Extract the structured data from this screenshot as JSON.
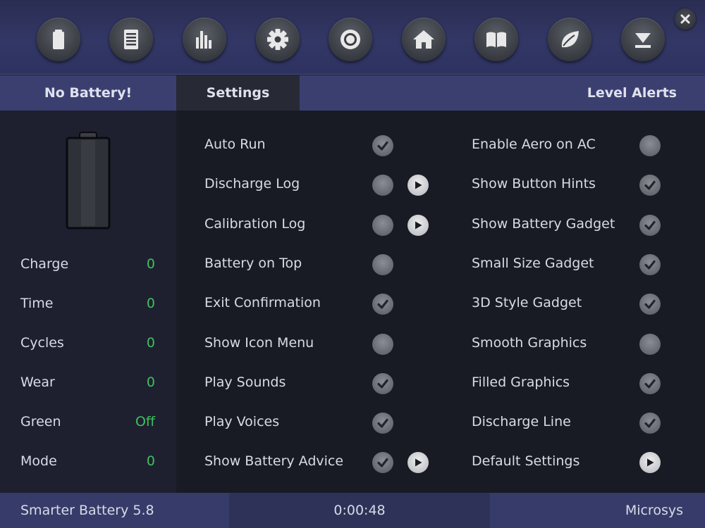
{
  "toolbar": {
    "buttons": [
      {
        "icon": "battery-icon"
      },
      {
        "icon": "document-icon"
      },
      {
        "icon": "bar-chart-icon"
      },
      {
        "icon": "gear-icon"
      },
      {
        "icon": "target-icon"
      },
      {
        "icon": "home-icon"
      },
      {
        "icon": "book-icon"
      },
      {
        "icon": "leaf-icon"
      },
      {
        "icon": "minimize-icon"
      }
    ],
    "close_icon": "close-icon"
  },
  "tabs": {
    "battery": "No Battery!",
    "settings": "Settings",
    "alerts": "Level Alerts"
  },
  "stats": [
    {
      "label": "Charge",
      "value": "0"
    },
    {
      "label": "Time",
      "value": "0"
    },
    {
      "label": "Cycles",
      "value": "0"
    },
    {
      "label": "Wear",
      "value": "0"
    },
    {
      "label": "Green",
      "value": "Off"
    },
    {
      "label": "Mode",
      "value": "0"
    }
  ],
  "settings_left": [
    {
      "label": "Auto Run",
      "checked": true,
      "has_arrow": false
    },
    {
      "label": "Discharge Log",
      "checked": false,
      "has_arrow": true
    },
    {
      "label": "Calibration Log",
      "checked": false,
      "has_arrow": true
    },
    {
      "label": "Battery on Top",
      "checked": false,
      "has_arrow": false
    },
    {
      "label": "Exit Confirmation",
      "checked": true,
      "has_arrow": false
    },
    {
      "label": "Show Icon Menu",
      "checked": false,
      "has_arrow": false
    },
    {
      "label": "Play Sounds",
      "checked": true,
      "has_arrow": false
    },
    {
      "label": "Play Voices",
      "checked": true,
      "has_arrow": false
    },
    {
      "label": "Show Battery Advice",
      "checked": true,
      "has_arrow": true
    }
  ],
  "settings_right": [
    {
      "label": "Enable Aero on AC",
      "checked": false,
      "has_arrow": false
    },
    {
      "label": "Show Button Hints",
      "checked": true,
      "has_arrow": false
    },
    {
      "label": "Show Battery Gadget",
      "checked": true,
      "has_arrow": false
    },
    {
      "label": "Small Size Gadget",
      "checked": true,
      "has_arrow": false
    },
    {
      "label": "3D Style Gadget",
      "checked": true,
      "has_arrow": false
    },
    {
      "label": "Smooth Graphics",
      "checked": false,
      "has_arrow": false
    },
    {
      "label": "Filled Graphics",
      "checked": true,
      "has_arrow": false
    },
    {
      "label": "Discharge Line",
      "checked": true,
      "has_arrow": false
    },
    {
      "label": "Default Settings",
      "checked": false,
      "has_arrow": true,
      "arrow_only": true
    }
  ],
  "status": {
    "app": "Smarter Battery 5.8",
    "time": "0:00:48",
    "company": "Microsys"
  },
  "colors": {
    "accent_green": "#3ec05a",
    "toolbar_bg": "#333765",
    "tabbar_bg": "#3b3f70",
    "panel_bg": "#191b24"
  }
}
